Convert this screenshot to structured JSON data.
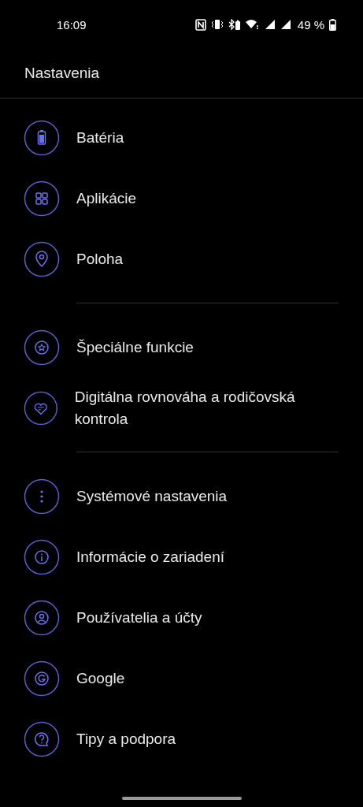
{
  "status_bar": {
    "time": "16:09",
    "battery_text": "49 %"
  },
  "header": {
    "title": "Nastavenia"
  },
  "sections": [
    {
      "items": [
        {
          "label": "Batéria",
          "kind": "battery"
        },
        {
          "label": "Aplikácie",
          "kind": "apps"
        },
        {
          "label": "Poloha",
          "kind": "location"
        }
      ]
    },
    {
      "items": [
        {
          "label": "Špeciálne funkcie",
          "kind": "accessibility"
        },
        {
          "label": "Digitálna rovnováha a rodičovská kontrola",
          "kind": "wellbeing"
        }
      ]
    },
    {
      "items": [
        {
          "label": "Systémové nastavenia",
          "kind": "system"
        },
        {
          "label": "Informácie o zariadení",
          "kind": "info"
        },
        {
          "label": "Používatelia a účty",
          "kind": "users"
        },
        {
          "label": "Google",
          "kind": "google"
        },
        {
          "label": "Tipy a podpora",
          "kind": "help"
        }
      ]
    }
  ]
}
